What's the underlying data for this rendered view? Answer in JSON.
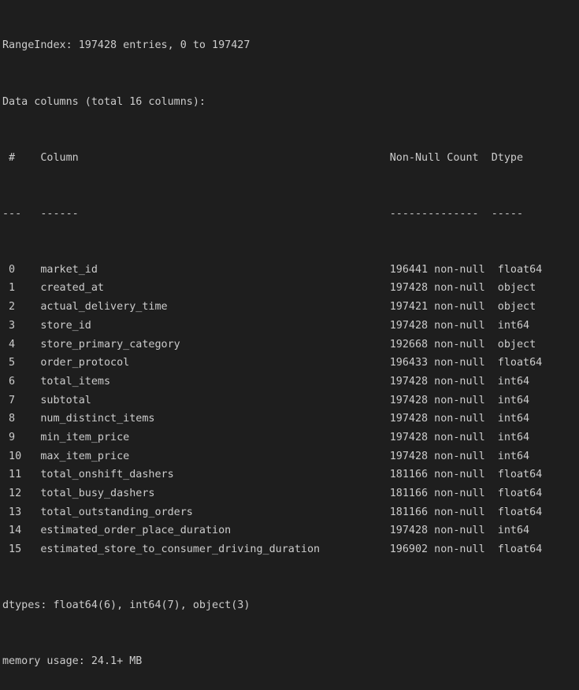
{
  "summary": {
    "range_index": "RangeIndex: 197428 entries, 0 to 197427",
    "data_columns": "Data columns (total 16 columns):"
  },
  "header": {
    "num": " #",
    "column": "Column",
    "non_null_count": "Non-Null Count",
    "dtype": "Dtype",
    "num_sep": "---",
    "column_sep": "------",
    "count_sep": "--------------",
    "dtype_sep": "-----"
  },
  "rows": [
    {
      "idx": " 0",
      "name": "market_id",
      "count": "196441",
      "nn": "non-null",
      "dtype": "float64"
    },
    {
      "idx": " 1",
      "name": "created_at",
      "count": "197428",
      "nn": "non-null",
      "dtype": "object"
    },
    {
      "idx": " 2",
      "name": "actual_delivery_time",
      "count": "197421",
      "nn": "non-null",
      "dtype": "object"
    },
    {
      "idx": " 3",
      "name": "store_id",
      "count": "197428",
      "nn": "non-null",
      "dtype": "int64"
    },
    {
      "idx": " 4",
      "name": "store_primary_category",
      "count": "192668",
      "nn": "non-null",
      "dtype": "object"
    },
    {
      "idx": " 5",
      "name": "order_protocol",
      "count": "196433",
      "nn": "non-null",
      "dtype": "float64"
    },
    {
      "idx": " 6",
      "name": "total_items",
      "count": "197428",
      "nn": "non-null",
      "dtype": "int64"
    },
    {
      "idx": " 7",
      "name": "subtotal",
      "count": "197428",
      "nn": "non-null",
      "dtype": "int64"
    },
    {
      "idx": " 8",
      "name": "num_distinct_items",
      "count": "197428",
      "nn": "non-null",
      "dtype": "int64"
    },
    {
      "idx": " 9",
      "name": "min_item_price",
      "count": "197428",
      "nn": "non-null",
      "dtype": "int64"
    },
    {
      "idx": " 10",
      "name": "max_item_price",
      "count": "197428",
      "nn": "non-null",
      "dtype": "int64"
    },
    {
      "idx": " 11",
      "name": "total_onshift_dashers",
      "count": "181166",
      "nn": "non-null",
      "dtype": "float64"
    },
    {
      "idx": " 12",
      "name": "total_busy_dashers",
      "count": "181166",
      "nn": "non-null",
      "dtype": "float64"
    },
    {
      "idx": " 13",
      "name": "total_outstanding_orders",
      "count": "181166",
      "nn": "non-null",
      "dtype": "float64"
    },
    {
      "idx": " 14",
      "name": "estimated_order_place_duration",
      "count": "197428",
      "nn": "non-null",
      "dtype": "int64"
    },
    {
      "idx": " 15",
      "name": "estimated_store_to_consumer_driving_duration",
      "count": "196902",
      "nn": "non-null",
      "dtype": "float64"
    }
  ],
  "footer": {
    "dtypes": "dtypes: float64(6), int64(7), object(3)",
    "memory": "memory usage: 24.1+ MB"
  },
  "colors": {
    "background": "#1e1e1e",
    "text": "#cccccc"
  }
}
